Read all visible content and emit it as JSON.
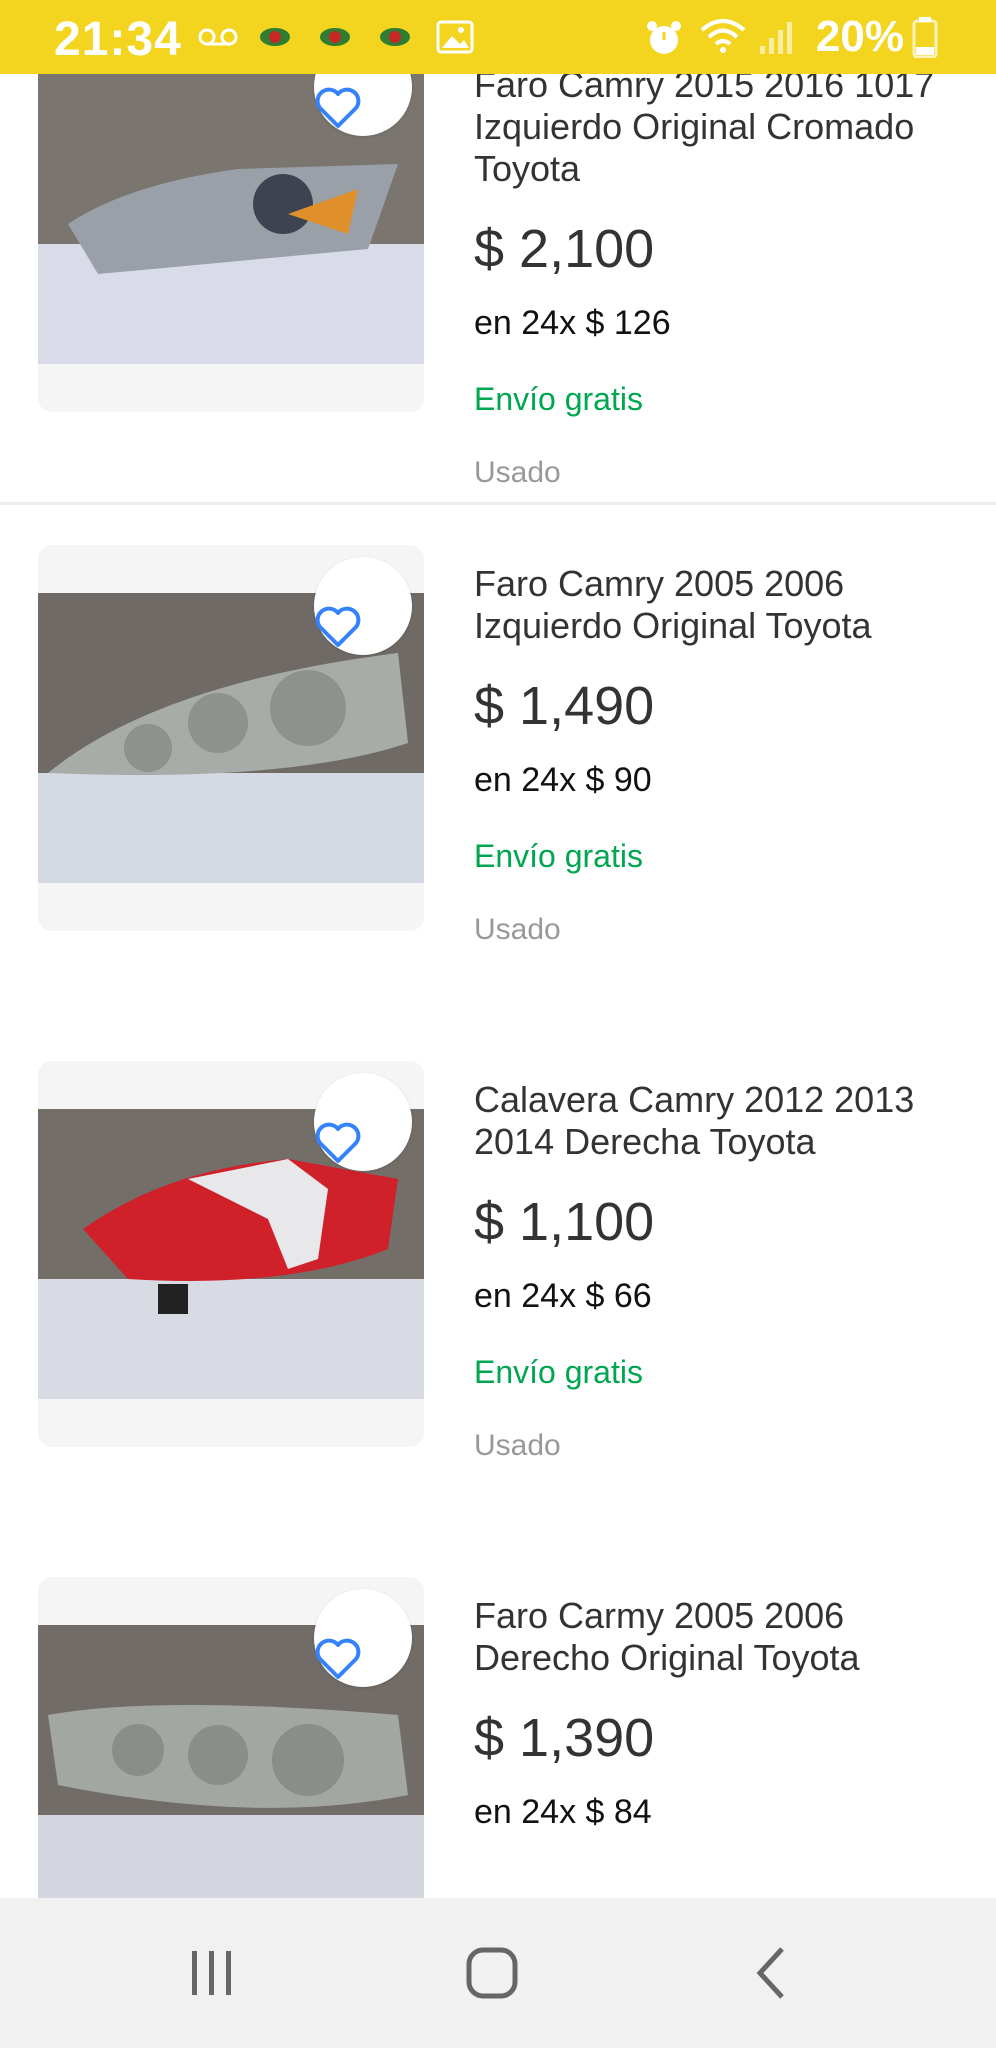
{
  "status_bar": {
    "time": "21:34",
    "battery_text": "20%",
    "icons_left": [
      "voicemail-icon",
      "app-icon",
      "app-icon",
      "app-icon",
      "gallery-icon"
    ],
    "icons_right": [
      "alarm-icon",
      "wifi-icon",
      "signal-icon",
      "battery-icon"
    ],
    "background": "#f3d51f"
  },
  "items": [
    {
      "title": "Faro Camry 2015 2016 1017 Izquierdo Original Cromado Toyota",
      "price": "$ 2,100",
      "installments": "en 24x $ 126",
      "shipping": "Envío gratis",
      "condition": "Usado"
    },
    {
      "title": "Faro Camry 2005 2006 Izquierdo Original Toyota",
      "price": "$ 1,490",
      "installments": "en 24x $ 90",
      "shipping": "Envío gratis",
      "condition": "Usado"
    },
    {
      "title": "Calavera Camry 2012 2013 2014 Derecha Toyota",
      "price": "$ 1,100",
      "installments": "en 24x $ 66",
      "shipping": "Envío gratis",
      "condition": "Usado"
    },
    {
      "title": "Faro Carmy 2005 2006 Derecho Original Toyota",
      "price": "$ 1,390",
      "installments": "en 24x $ 84"
    }
  ],
  "colors": {
    "shipping_green": "#00a650",
    "heart_blue": "#3483fa",
    "price_text": "#333333"
  },
  "nav_bar": {
    "buttons": [
      "recent-apps-icon",
      "home-icon",
      "back-icon"
    ]
  }
}
